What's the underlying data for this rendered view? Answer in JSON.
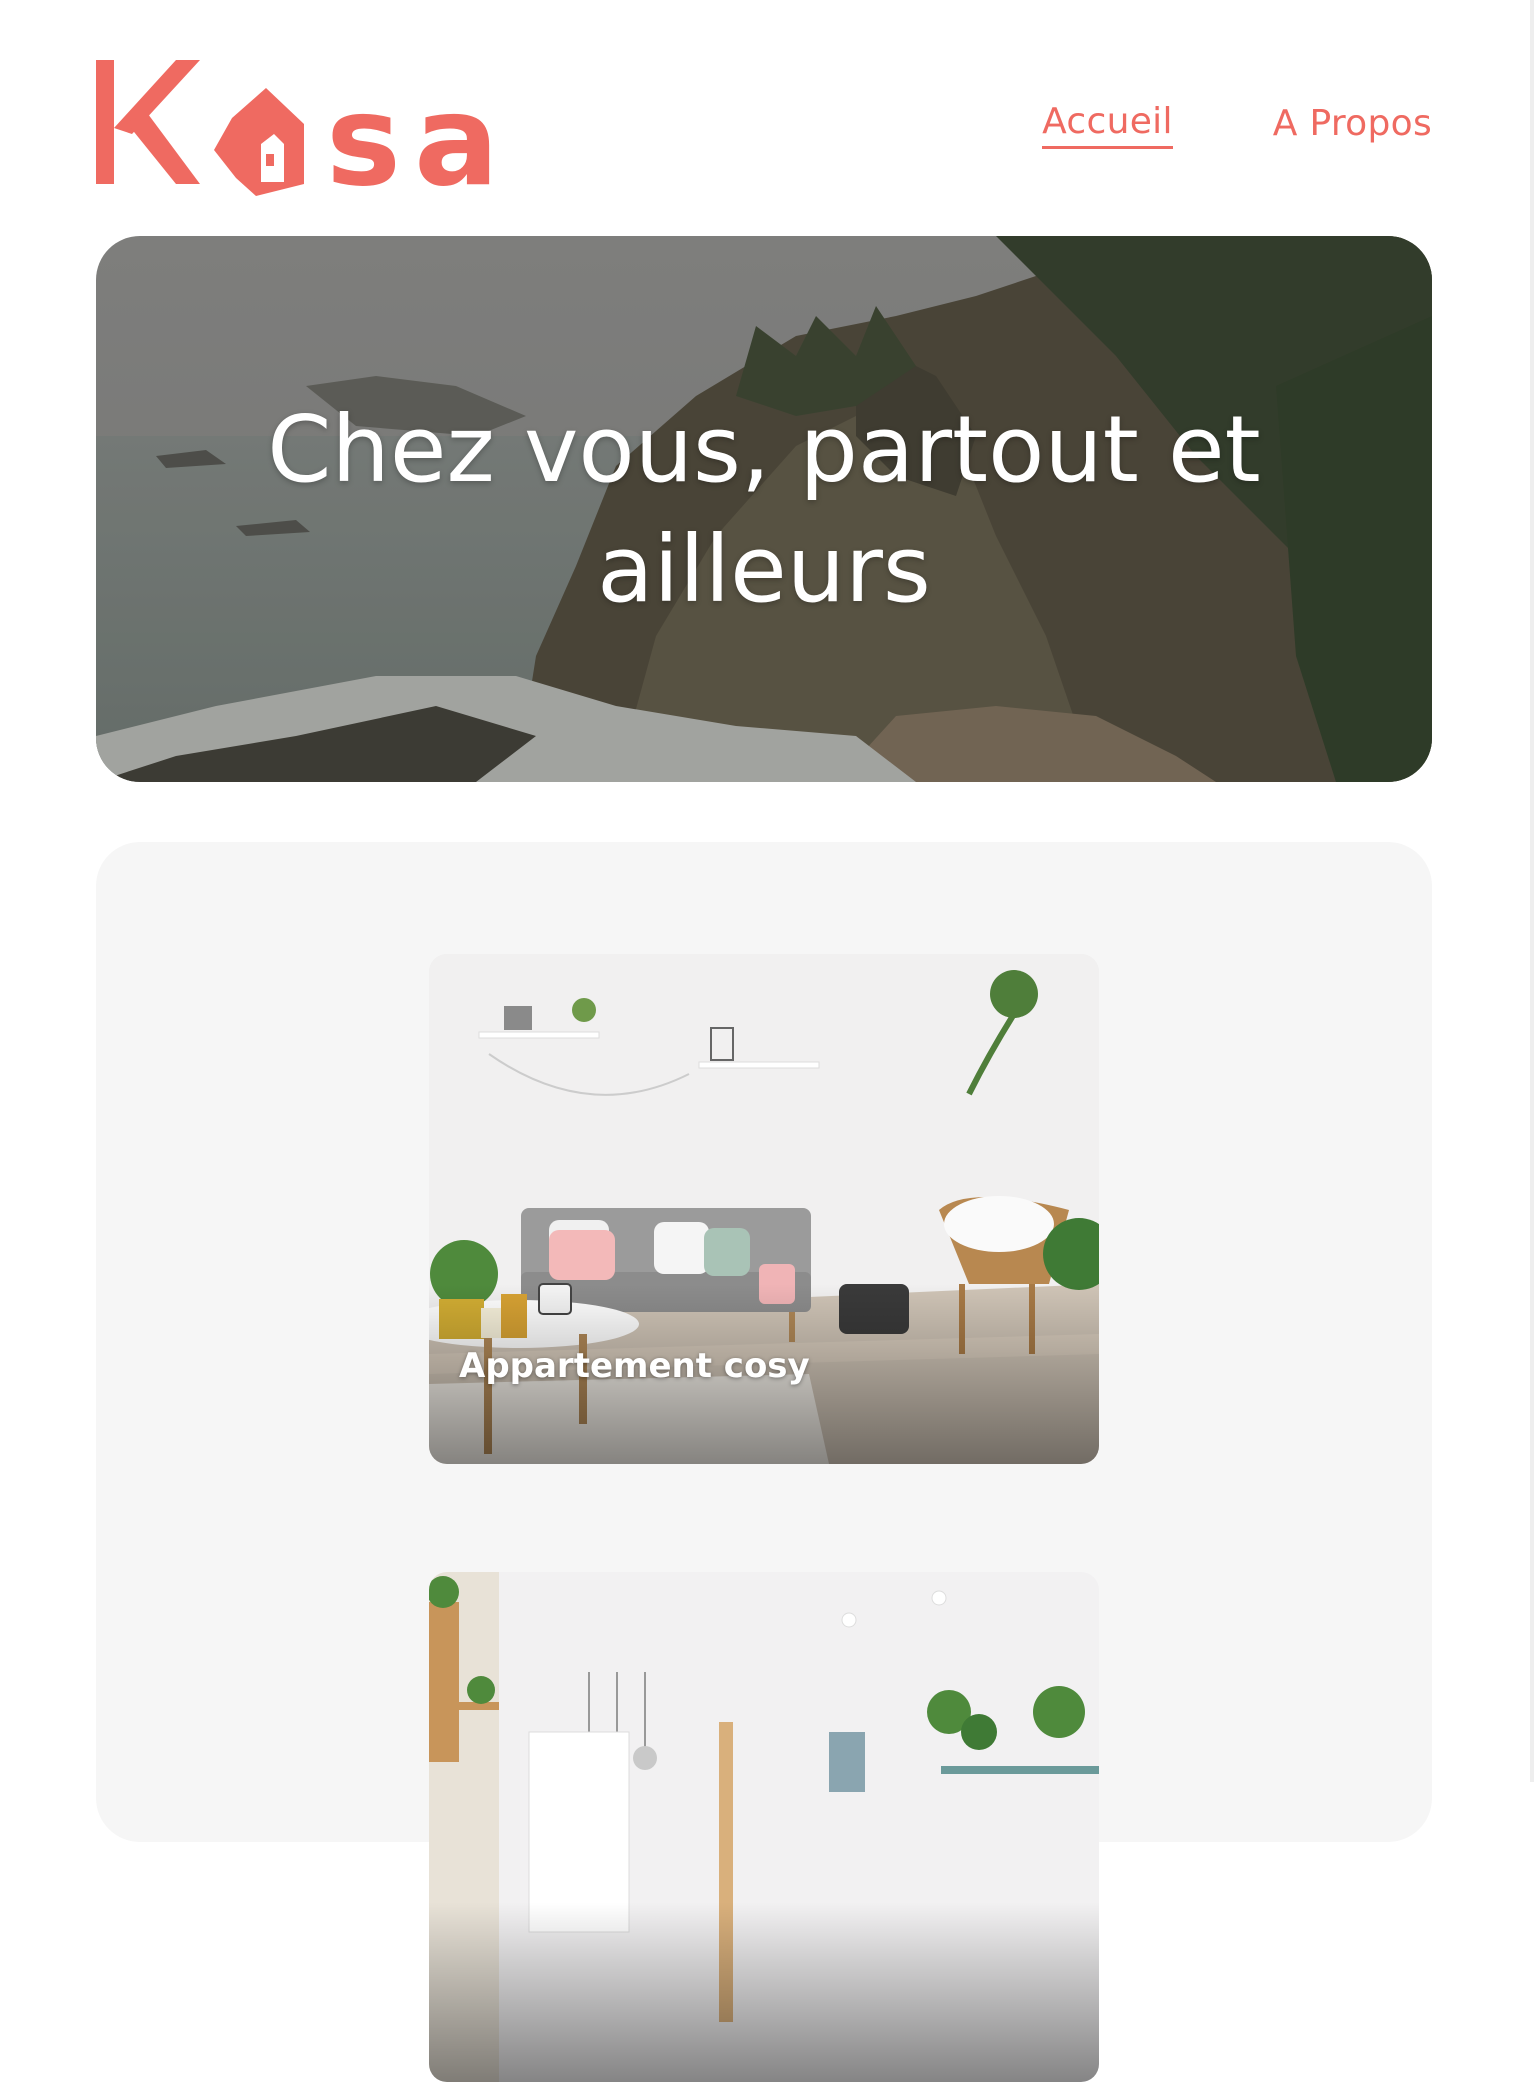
{
  "brand": {
    "name": "Kasa",
    "color": "#ef6a61"
  },
  "nav": {
    "items": [
      {
        "label": "Accueil",
        "active": true
      },
      {
        "label": "A Propos",
        "active": false
      }
    ]
  },
  "hero": {
    "title": "Chez vous, partout et ailleurs"
  },
  "listings": [
    {
      "title": "Appartement cosy"
    },
    {
      "title": ""
    }
  ]
}
